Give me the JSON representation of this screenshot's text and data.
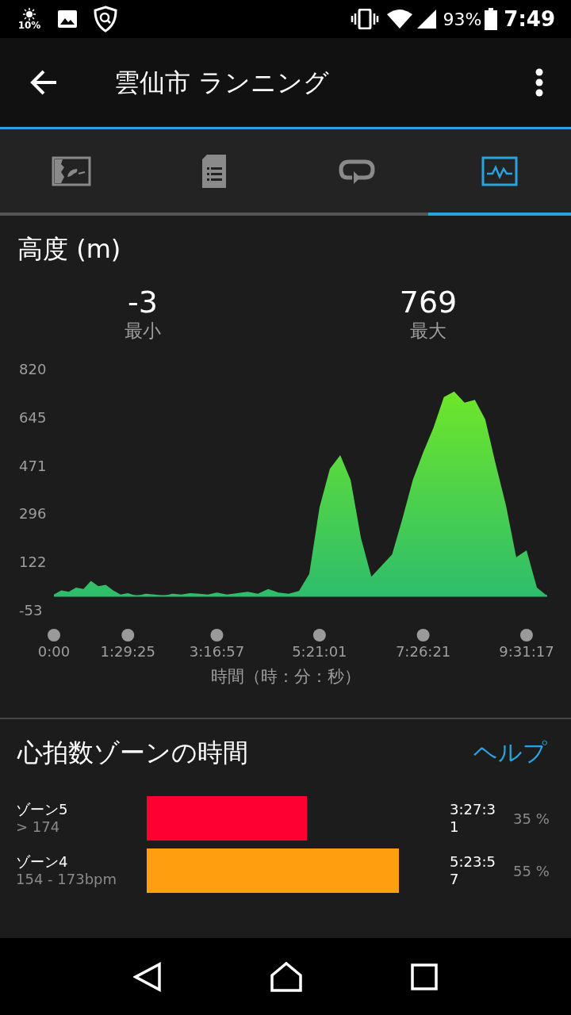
{
  "status_bar": {
    "brightness": "10%",
    "battery": "93%",
    "time": "7:49"
  },
  "app_bar": {
    "title": "雲仙市 ランニング"
  },
  "tabs": [
    {
      "kind": "map",
      "selected": false
    },
    {
      "kind": "details",
      "selected": false
    },
    {
      "kind": "laps",
      "selected": false
    },
    {
      "kind": "graph",
      "selected": true
    }
  ],
  "elevation": {
    "title": "高度 (m)",
    "stats": [
      {
        "value": "-3",
        "label": "最小"
      },
      {
        "value": "769",
        "label": "最大"
      }
    ],
    "chart_data": {
      "type": "area",
      "xlabel": "時間（時：分：秒）",
      "ylim": [
        -53,
        820
      ],
      "yticks": [
        820,
        645,
        471,
        296,
        122,
        -53
      ],
      "xlim": [
        0,
        35776
      ],
      "xticks": [
        {
          "value": 0,
          "label": "0:00"
        },
        {
          "value": 5365,
          "label": "1:29:25"
        },
        {
          "value": 11817,
          "label": "3:16:57"
        },
        {
          "value": 19261,
          "label": "5:21:01"
        },
        {
          "value": 26781,
          "label": "7:26:21"
        },
        {
          "value": 34277,
          "label": "9:31:17"
        }
      ],
      "x": [
        0,
        537,
        1073,
        1610,
        2146,
        2683,
        3219,
        3756,
        4292,
        4829,
        5365,
        6010,
        6655,
        7301,
        7946,
        8591,
        9236,
        9881,
        10527,
        11172,
        11817,
        12561,
        13306,
        14050,
        14795,
        15539,
        16283,
        17028,
        17772,
        18517,
        19261,
        20013,
        20765,
        21517,
        22269,
        23021,
        23773,
        24525,
        25277,
        26029,
        26781,
        27531,
        28280,
        29030,
        29780,
        30529,
        31279,
        32028,
        32778,
        33528,
        34277,
        35027,
        35776
      ],
      "series": [
        {
          "color": "#2ebd6b",
          "values": [
            5,
            20,
            15,
            30,
            25,
            55,
            35,
            40,
            20,
            5,
            10,
            0,
            8,
            5,
            0,
            8,
            5,
            10,
            8,
            5,
            12,
            5,
            10,
            15,
            8,
            25,
            12,
            8,
            18,
            80,
            320,
            460,
            510,
            420,
            210,
            70,
            110,
            150,
            280,
            420,
            520,
            610,
            720,
            740,
            700,
            710,
            640,
            480,
            330,
            140,
            165,
            30,
            0
          ]
        }
      ]
    }
  },
  "heart_rate": {
    "title": "心拍数ゾーンの時間",
    "help": "ヘルプ",
    "zones": [
      {
        "name": "ゾーン5",
        "range": "> 174",
        "color": "#ff0033",
        "time": "3:27:31",
        "percent": "35 %"
      },
      {
        "name": "ゾーン4",
        "range": "154 - 173bpm",
        "color": "#ff9f10",
        "time": "5:23:57",
        "percent": "55 %"
      }
    ]
  }
}
